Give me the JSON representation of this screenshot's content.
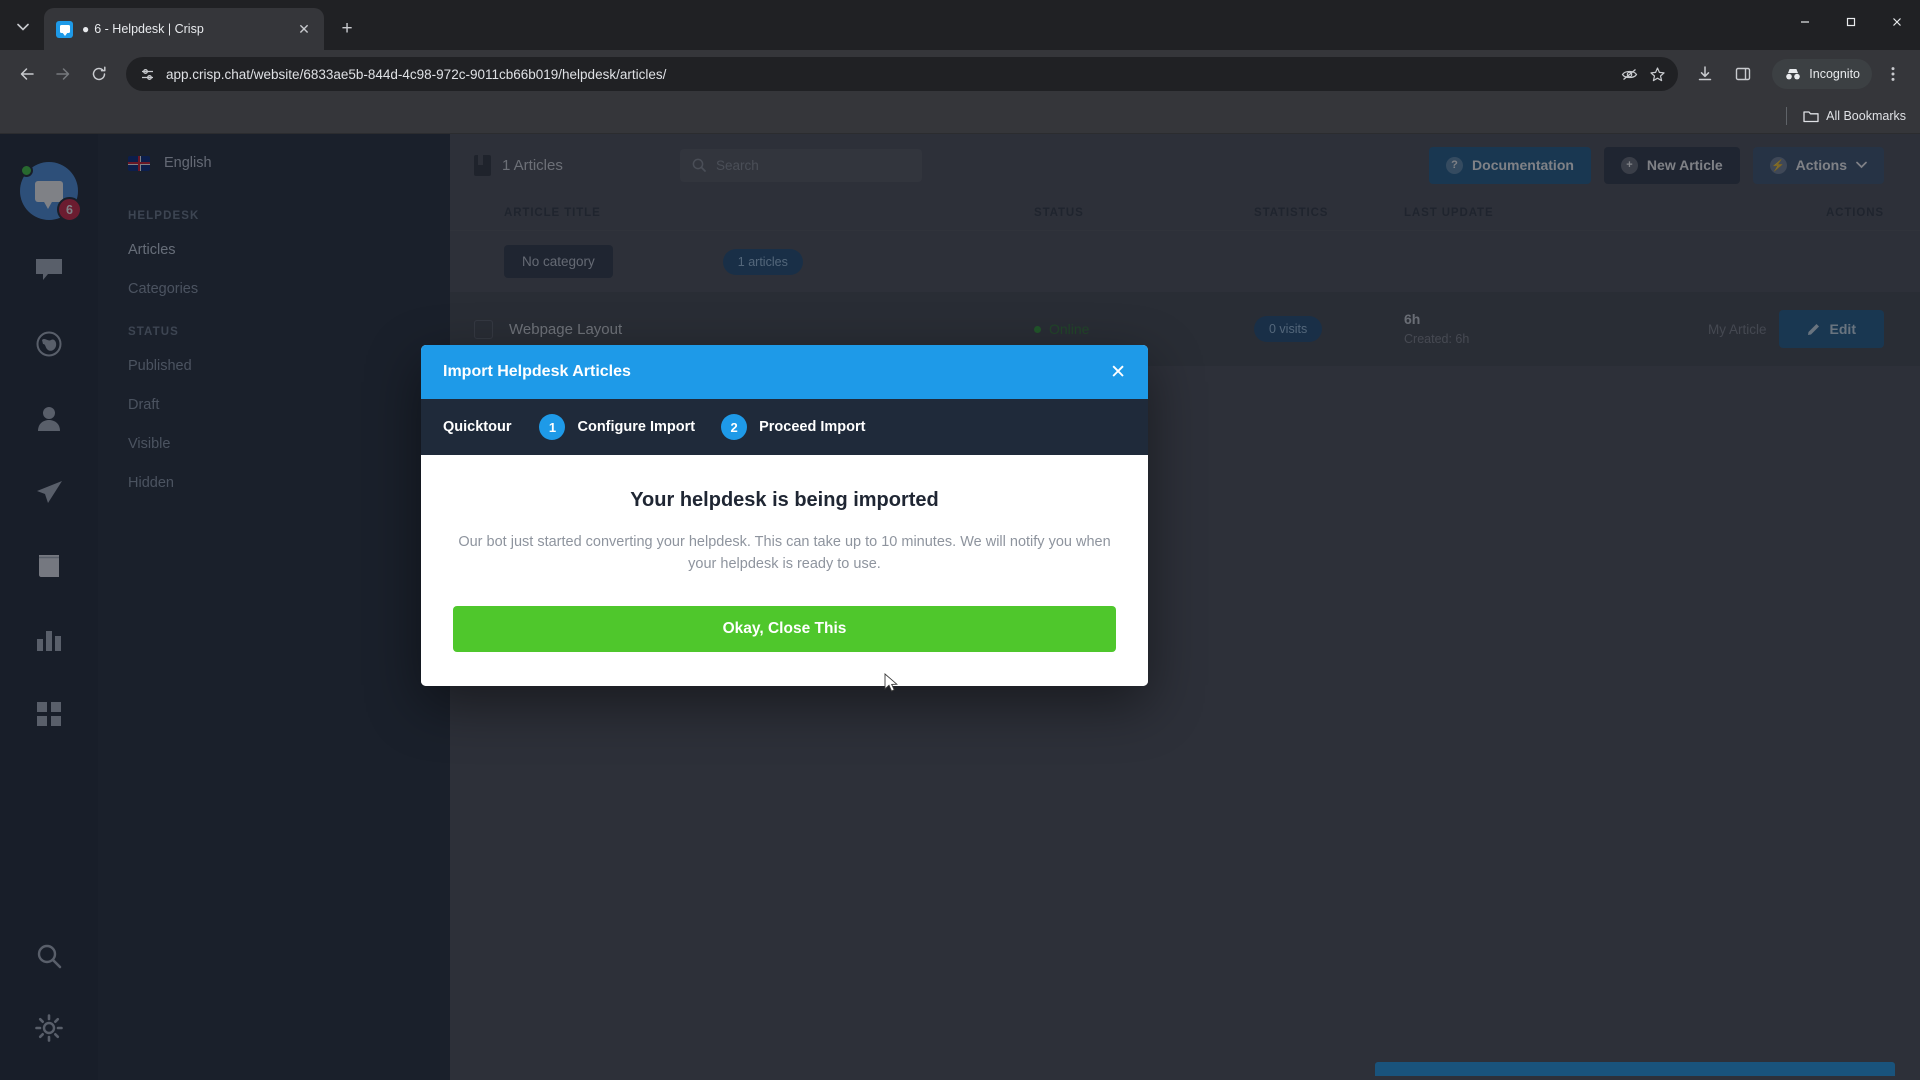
{
  "browser": {
    "tab": {
      "unread_glyph": "●",
      "title": "6 - Helpdesk | Crisp",
      "close_label": "✕"
    },
    "new_tab_label": "+",
    "nav": {
      "back": "←",
      "forward": "→",
      "reload": "⟳"
    },
    "omnibox": {
      "url": "app.crisp.chat/website/6833ae5b-844d-4c98-972c-9011cb66b019/helpdesk/articles/",
      "site_settings_icon": "tune-icon",
      "hide_icon": "eye-off-icon",
      "bookmark_icon": "star-icon"
    },
    "download_icon": "download-icon",
    "side_panel_icon": "side-panel-icon",
    "incognito_label": "Incognito",
    "menu_icon": "kebab-menu-icon",
    "bookmarks": {
      "all_bookmarks_label": "All Bookmarks"
    },
    "window": {
      "minimize": "—",
      "maximize": "▢",
      "close": "✕"
    }
  },
  "rail": {
    "badge_count": "6",
    "items": [
      {
        "name": "inbox-icon"
      },
      {
        "name": "globe-icon"
      },
      {
        "name": "contacts-icon"
      },
      {
        "name": "campaigns-icon"
      },
      {
        "name": "helpdesk-book-icon"
      },
      {
        "name": "analytics-icon"
      },
      {
        "name": "plugins-icon"
      }
    ],
    "bottom": [
      {
        "name": "search-icon"
      },
      {
        "name": "settings-gear-icon"
      }
    ]
  },
  "sidebar": {
    "language": "English",
    "sections": [
      {
        "header": "HELPDESK",
        "items": [
          {
            "label": "Articles",
            "active": true
          },
          {
            "label": "Categories",
            "active": false
          }
        ]
      },
      {
        "header": "STATUS",
        "items": [
          {
            "label": "Published",
            "active": false
          },
          {
            "label": "Draft",
            "active": false
          },
          {
            "label": "Visible",
            "active": false
          },
          {
            "label": "Hidden",
            "active": false
          }
        ]
      }
    ]
  },
  "main": {
    "articles_count_label": "1 Articles",
    "search_placeholder": "Search",
    "buttons": {
      "documentation": "Documentation",
      "new_article": "New Article",
      "actions": "Actions"
    },
    "table": {
      "columns": [
        "ARTICLE TITLE",
        "STATUS",
        "STATISTICS",
        "LAST UPDATE",
        "ACTIONS"
      ],
      "category_row": {
        "category_label": "No category",
        "count_label": "1 articles"
      },
      "rows": [
        {
          "title": "Webpage Layout",
          "status": "Online",
          "statistics": "0 visits",
          "last_update": "6h",
          "created": "Created: 6h",
          "preview_label": "My Article",
          "edit_label": "Edit"
        }
      ]
    }
  },
  "modal": {
    "title": "Import Helpdesk Articles",
    "close_label": "✕",
    "quicktour_label": "Quicktour",
    "steps": [
      {
        "num": "1",
        "label": "Configure Import"
      },
      {
        "num": "2",
        "label": "Proceed Import"
      }
    ],
    "heading": "Your helpdesk is being imported",
    "paragraph": "Our bot just started converting your helpdesk. This can take up to 10 minutes. We will notify you when your helpdesk is ready to use.",
    "button_label": "Okay, Close This"
  },
  "colors": {
    "brand_blue": "#1e9ae8",
    "success_green": "#4fc72c",
    "online_green": "#2f9e34",
    "badge_red": "#d32140",
    "dark_panel": "#1f2a3a"
  }
}
